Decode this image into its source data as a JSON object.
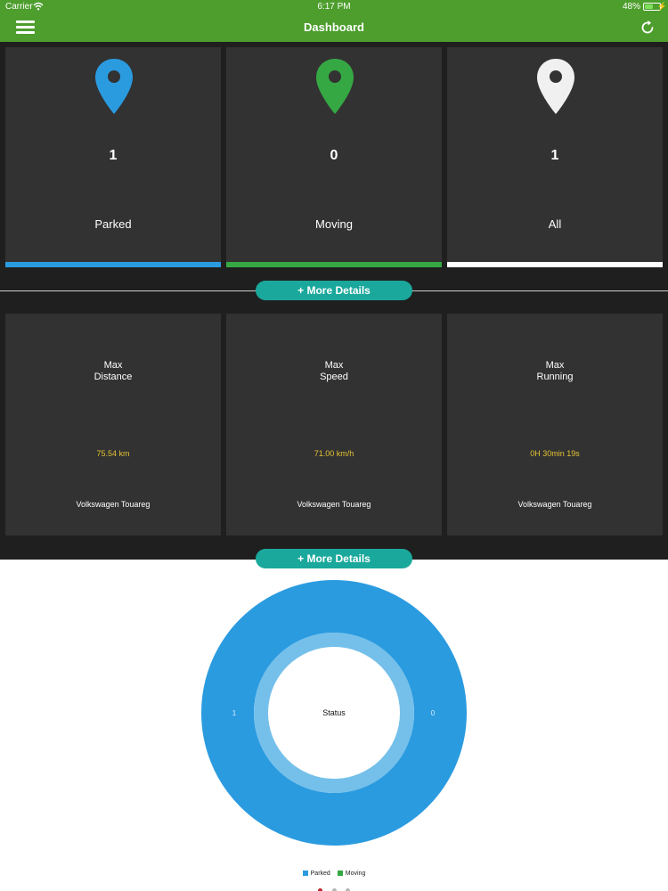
{
  "status_bar": {
    "carrier": "Carrier",
    "time": "6:17 PM",
    "battery": "48%"
  },
  "header": {
    "title": "Dashboard",
    "menu_icon": "hamburger-menu-icon",
    "refresh_icon": "refresh-icon"
  },
  "status_cards": [
    {
      "count": "1",
      "label": "Parked",
      "color": "#2b9be0",
      "icon": "location-pin-icon"
    },
    {
      "count": "0",
      "label": "Moving",
      "color": "#35a843",
      "icon": "location-pin-icon"
    },
    {
      "count": "1",
      "label": "All",
      "color": "#ffffff",
      "icon": "location-pin-icon"
    }
  ],
  "more_details_label": "+ More Details",
  "max_cards": [
    {
      "title": "Max\nDistance",
      "value": "75.54 km",
      "vehicle": "Volkswagen Touareg"
    },
    {
      "title": "Max\nSpeed",
      "value": "71.00 km/h",
      "vehicle": "Volkswagen Touareg"
    },
    {
      "title": "Max\nRunning",
      "value": "0H 30min 19s",
      "vehicle": "Volkswagen Touareg"
    }
  ],
  "chart_data": {
    "type": "pie",
    "title": "",
    "center_label": "Status",
    "categories": [
      "Parked",
      "Moving"
    ],
    "values": [
      1,
      0
    ],
    "colors": [
      "#2b9be0",
      "#35a843"
    ],
    "legend_position": "bottom"
  },
  "colors": {
    "accent": "#4d9e2d",
    "button": "#1ba89c",
    "value_text": "#e5c234",
    "chart_inner_ring": "#74c0ea"
  },
  "page_indicator": {
    "count": 3,
    "active": 0,
    "active_color": "#c0272d"
  }
}
